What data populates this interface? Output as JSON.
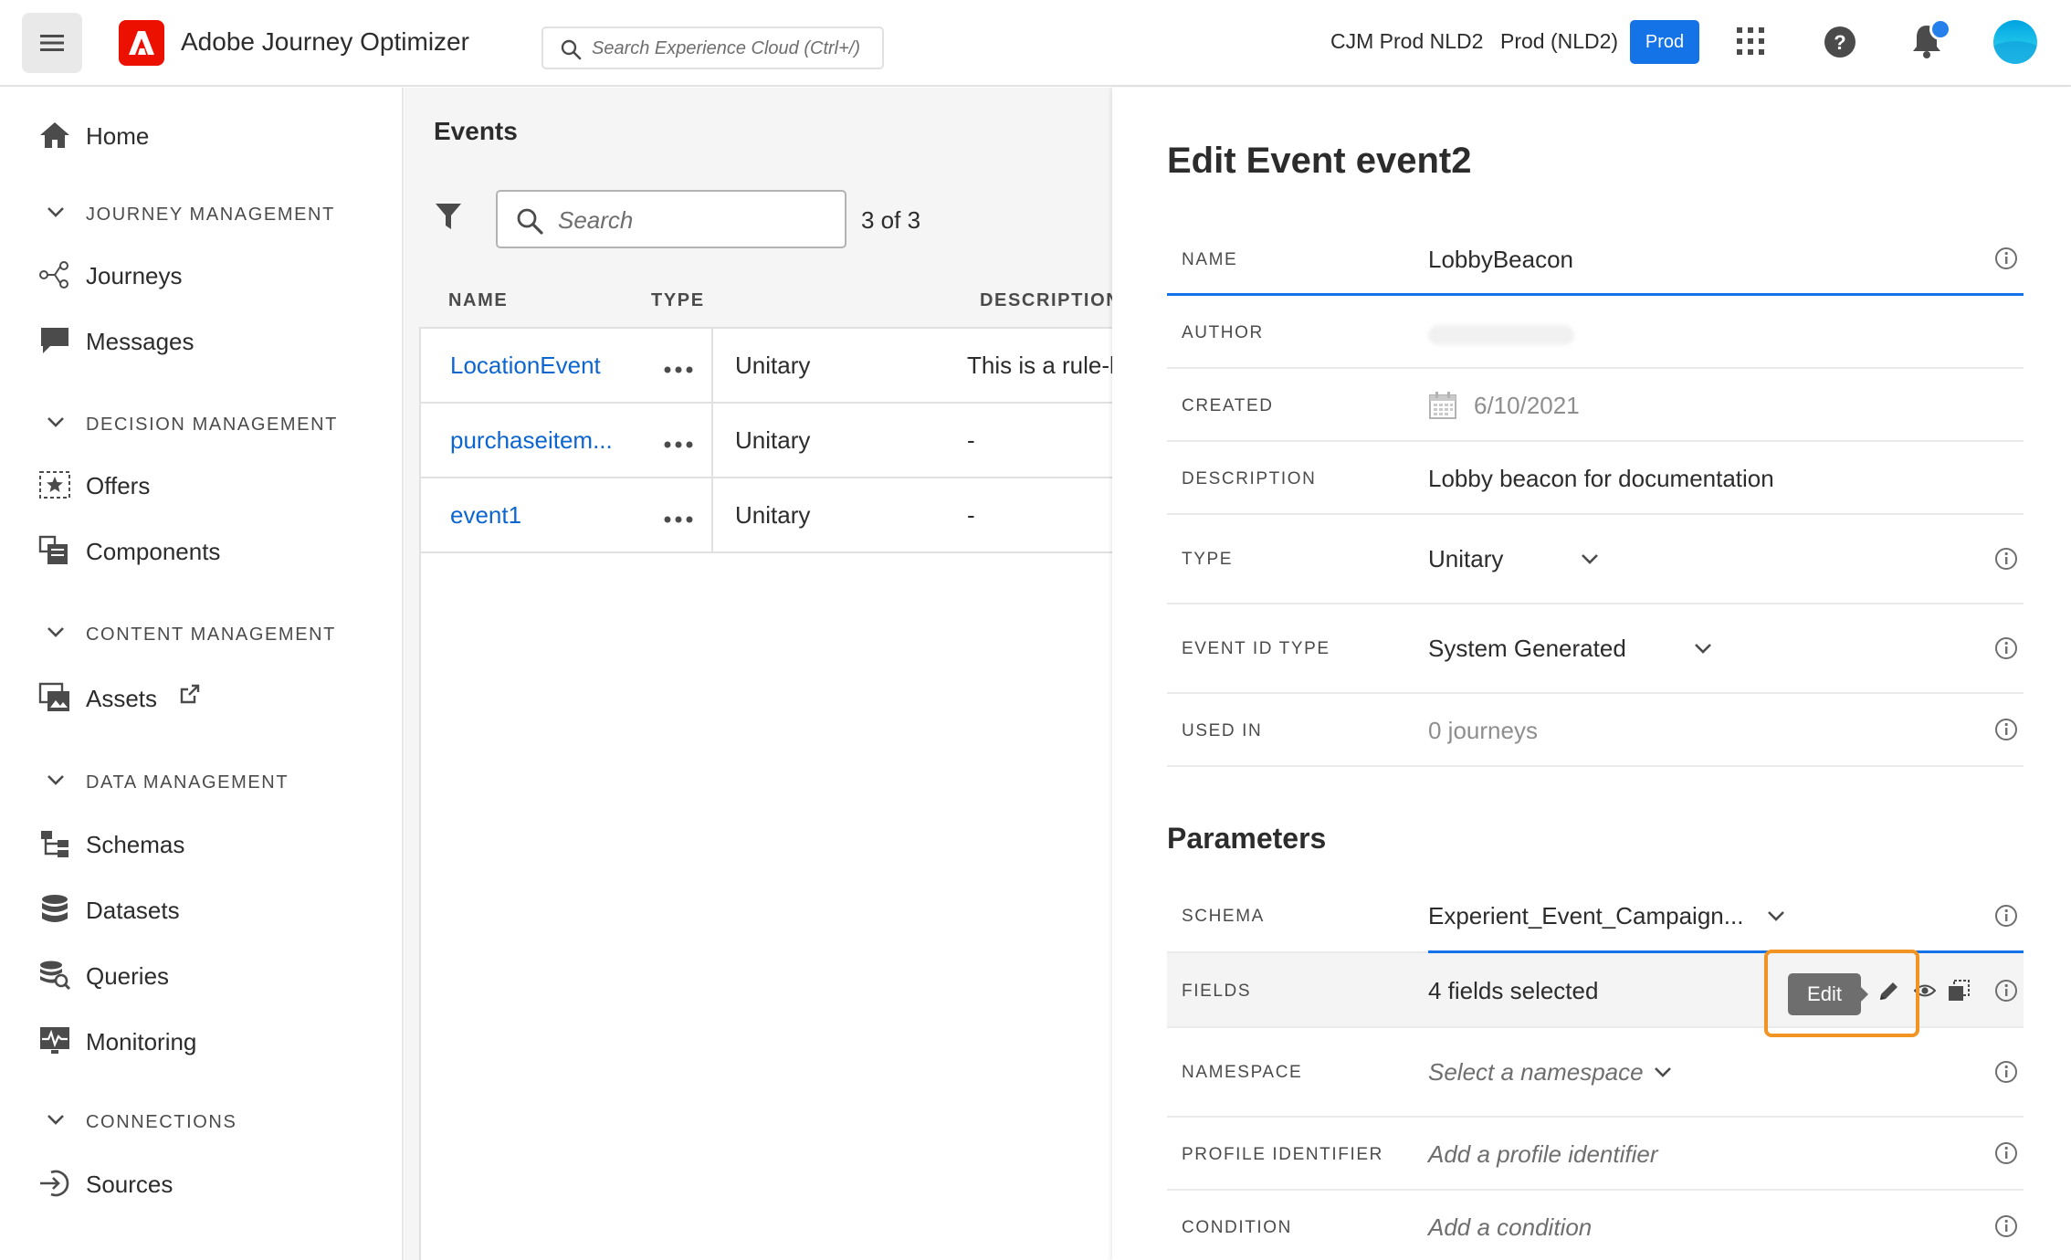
{
  "topbar": {
    "app_title": "Adobe Journey Optimizer",
    "search_placeholder": "Search Experience Cloud (Ctrl+/)",
    "org_name": "CJM Prod NLD2",
    "sandbox_name": "Prod (NLD2)",
    "env_badge": "Prod",
    "brand_color": "#eb1000",
    "accent_color": "#1473e6",
    "icons": [
      "hamburger-icon",
      "adobe-logo-icon",
      "search-icon",
      "apps-grid-icon",
      "help-icon",
      "bell-icon",
      "avatar"
    ]
  },
  "sidebar": {
    "home": "Home",
    "sections": {
      "journey_management": "JOURNEY MANAGEMENT",
      "decision_management": "DECISION MANAGEMENT",
      "content_management": "CONTENT MANAGEMENT",
      "data_management": "DATA MANAGEMENT",
      "connections": "CONNECTIONS"
    },
    "items": {
      "journeys": "Journeys",
      "messages": "Messages",
      "offers": "Offers",
      "components": "Components",
      "assets": "Assets",
      "schemas": "Schemas",
      "datasets": "Datasets",
      "queries": "Queries",
      "monitoring": "Monitoring",
      "sources": "Sources"
    }
  },
  "events": {
    "title": "Events",
    "search_placeholder": "Search",
    "count": "3 of 3",
    "columns": [
      "NAME",
      "TYPE",
      "DESCRIPTION"
    ],
    "rows": [
      {
        "name": "LocationEvent",
        "type": "Unitary",
        "description": "This is a rule-b"
      },
      {
        "name": "purchaseitem...",
        "type": "Unitary",
        "description": "-"
      },
      {
        "name": "event1",
        "type": "Unitary",
        "description": "-"
      }
    ]
  },
  "edit_event": {
    "title": "Edit Event event2",
    "fields": {
      "name": {
        "label": "NAME",
        "value": "LobbyBeacon"
      },
      "author": {
        "label": "AUTHOR",
        "value": ""
      },
      "created": {
        "label": "CREATED",
        "value": "6/10/2021"
      },
      "description": {
        "label": "DESCRIPTION",
        "value": "Lobby beacon for documentation"
      },
      "type": {
        "label": "TYPE",
        "value": "Unitary"
      },
      "event_id_type": {
        "label": "EVENT ID TYPE",
        "value": "System Generated"
      },
      "used_in": {
        "label": "USED IN",
        "value": "0 journeys"
      }
    },
    "parameters_title": "Parameters",
    "parameters": {
      "schema": {
        "label": "SCHEMA",
        "value": "Experient_Event_Campaign..."
      },
      "fields": {
        "label": "FIELDS",
        "value": "4 fields selected"
      },
      "namespace": {
        "label": "NAMESPACE",
        "placeholder": "Select a namespace"
      },
      "profile_identifier": {
        "label": "PROFILE IDENTIFIER",
        "placeholder": "Add a profile identifier"
      },
      "condition": {
        "label": "CONDITION",
        "placeholder": "Add a condition"
      }
    },
    "edit_tooltip": "Edit",
    "callout_color": "#f29423"
  }
}
